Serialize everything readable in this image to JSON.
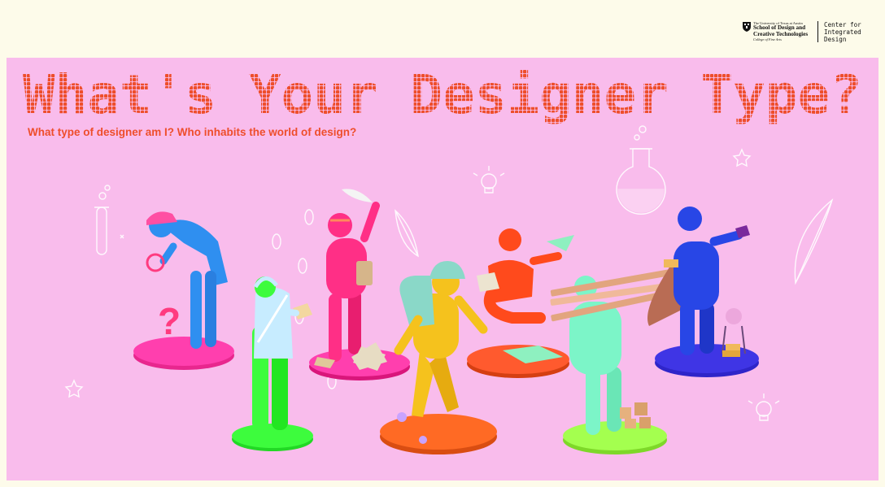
{
  "header": {
    "ut_line1": "The University of Texas at Austin",
    "ut_line2a": "School of Design and",
    "ut_line2b": "Creative Technologies",
    "ut_line3": "College of Fine Arts",
    "cid_line1": "Center for",
    "cid_line2": "Integrated",
    "cid_line3": "Design"
  },
  "hero": {
    "headline": "What's Your Designer Type?",
    "subtitle": "What type of designer am I? Who inhabits the world of design?"
  },
  "colors": {
    "background": "#f9bcec",
    "cream": "#fdfbea",
    "headline": "#ee4e2b"
  },
  "figures": [
    {
      "name": "investigator",
      "color": "#2f8ff0",
      "base": "#ff3fae"
    },
    {
      "name": "scientist",
      "color": "#c7ecff",
      "base": "#3dfc3d"
    },
    {
      "name": "writer",
      "color": "#ff2f86",
      "base": "#ff3fae"
    },
    {
      "name": "explorer",
      "color": "#f5c21d",
      "base": "#ff6a24"
    },
    {
      "name": "reader",
      "color": "#ff4a1c",
      "base": "#ff5a2e"
    },
    {
      "name": "builder",
      "color": "#7cf5c8",
      "base": "#a4ff4f"
    },
    {
      "name": "alchemist",
      "color": "#2846e6",
      "base": "#3f35e5"
    }
  ]
}
